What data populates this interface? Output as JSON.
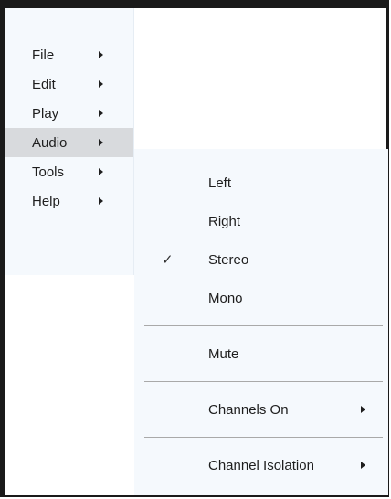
{
  "menubar": {
    "items": [
      {
        "label": "File"
      },
      {
        "label": "Edit"
      },
      {
        "label": "Play"
      },
      {
        "label": "Audio"
      },
      {
        "label": "Tools"
      },
      {
        "label": "Help"
      }
    ],
    "active_index": 3
  },
  "submenu": {
    "groups": [
      [
        {
          "label": "Left",
          "checked": false
        },
        {
          "label": "Right",
          "checked": false
        },
        {
          "label": "Stereo",
          "checked": true
        },
        {
          "label": "Mono",
          "checked": false
        }
      ],
      [
        {
          "label": "Mute"
        }
      ],
      [
        {
          "label": "Channels On",
          "has_submenu": true
        }
      ],
      [
        {
          "label": "Channel Isolation",
          "has_submenu": true
        }
      ]
    ],
    "check_glyph": "✓"
  },
  "colors": {
    "menu_bg": "#f5f9fd",
    "active_bg": "#d8dadd",
    "separator": "#a9a9a9",
    "text": "#1e1e1e"
  }
}
